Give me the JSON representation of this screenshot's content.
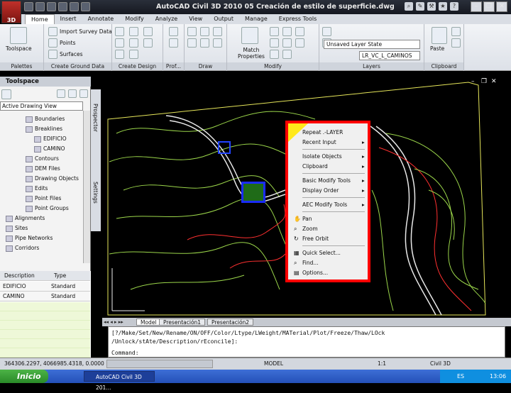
{
  "app": {
    "title": "AutoCAD Civil 3D 2010    05 Creación de estilo de superficie.dwg",
    "logo_text": "3D"
  },
  "menubar": {
    "tabs": [
      "Home",
      "Insert",
      "Annotate",
      "Modify",
      "Analyze",
      "View",
      "Output",
      "Manage",
      "Express Tools"
    ],
    "active": "Home"
  },
  "ribbon": {
    "toolspace_label": "Toolspace",
    "import_survey": "Import Survey Data",
    "points": "Points",
    "surfaces": "Surfaces",
    "match_properties": "Match Properties",
    "layer_state": "Unsaved Layer State",
    "layer_name": "LR_VC_L_CAMINOS",
    "paste": "Paste",
    "panels": [
      "Palettes",
      "Create Ground Data",
      "Create Design",
      "Prof...",
      "Draw",
      "Modify",
      "Layers",
      "Clipboard"
    ]
  },
  "toolspace": {
    "title": "Toolspace",
    "view": "Active Drawing View",
    "tree": [
      "Boundaries",
      "Breaklines",
      "EDIFICIO",
      "CAMINO",
      "Contours",
      "DEM Files",
      "Drawing Objects",
      "Edits",
      "Point Files",
      "Point Groups",
      "Alignments",
      "Sites",
      "Pipe Networks",
      "Corridors"
    ],
    "side_tabs": [
      "Prospector",
      "Settings"
    ]
  },
  "properties": {
    "headers": [
      "Description",
      "Type"
    ],
    "rows": [
      [
        "EDIFICIO",
        "Standard"
      ],
      [
        "CAMINO",
        "Standard"
      ]
    ]
  },
  "context_menu": {
    "items": [
      "Repeat .-LAYER",
      "Recent Input",
      "Isolate Objects",
      "Clipboard",
      "Basic Modify Tools",
      "Display Order",
      "AEC Modify Tools",
      "Pan",
      "Zoom",
      "Free Orbit",
      "Quick Select...",
      "Find...",
      "Options..."
    ]
  },
  "layout_tabs": [
    "Model",
    "Presentación1",
    "Presentación2"
  ],
  "command": {
    "line1": "[?/Make/Set/New/Rename/ON/OFF/Color/Ltype/LWeight/MATerial/Plot/Freeze/Thaw/LOck",
    "line2": "/Unlock/stAte/Description/rEconcile]:",
    "prompt": "Command:"
  },
  "status": {
    "coords": "364306.2297, 4066985.4318, 0.0000",
    "model": "MODEL",
    "scale": "1:1",
    "workspace": "Civil 3D"
  },
  "taskbar": {
    "start": "Inicio",
    "task": "AutoCAD Civil 3D 201...",
    "lang": "ES",
    "time": "13:06"
  }
}
